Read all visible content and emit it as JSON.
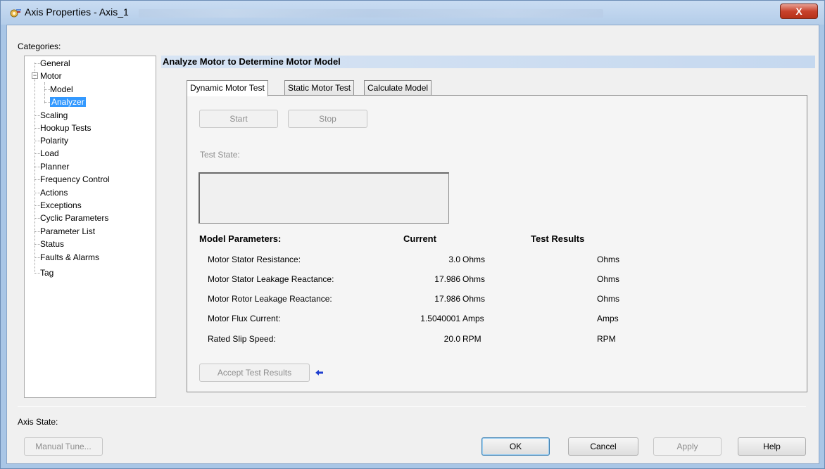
{
  "window": {
    "title": "Axis Properties - Axis_1",
    "close_label": "X"
  },
  "categories": {
    "label": "Categories:",
    "items": [
      {
        "label": "General"
      },
      {
        "label": "Motor"
      },
      {
        "label": "Model"
      },
      {
        "label": "Analyzer"
      },
      {
        "label": "Scaling"
      },
      {
        "label": "Hookup Tests"
      },
      {
        "label": "Polarity"
      },
      {
        "label": "Load"
      },
      {
        "label": "Planner"
      },
      {
        "label": "Frequency Control"
      },
      {
        "label": "Actions"
      },
      {
        "label": "Exceptions"
      },
      {
        "label": "Cyclic Parameters"
      },
      {
        "label": "Parameter List"
      },
      {
        "label": "Status"
      },
      {
        "label": "Faults & Alarms"
      },
      {
        "label": "Tag"
      }
    ],
    "selected": "Analyzer",
    "expander_symbol": "−"
  },
  "section": {
    "title": "Analyze Motor to Determine Motor Model"
  },
  "tabs": [
    {
      "label": "Dynamic Motor Test",
      "active": true
    },
    {
      "label": "Static Motor Test",
      "active": false
    },
    {
      "label": "Calculate Model",
      "active": false
    }
  ],
  "panel": {
    "start_label": "Start",
    "stop_label": "Stop",
    "test_state_label": "Test State:",
    "headers": {
      "model_parameters": "Model Parameters:",
      "current": "Current",
      "test_results": "Test Results"
    },
    "rows": [
      {
        "name": "Motor Stator Resistance:",
        "current": "3.0",
        "unit": "Ohms",
        "result_unit": "Ohms"
      },
      {
        "name": "Motor Stator Leakage Reactance:",
        "current": "17.986",
        "unit": "Ohms",
        "result_unit": "Ohms"
      },
      {
        "name": "Motor Rotor Leakage Reactance:",
        "current": "17.986",
        "unit": "Ohms",
        "result_unit": "Ohms"
      },
      {
        "name": "Motor Flux Current:",
        "current": "1.5040001",
        "unit": "Amps",
        "result_unit": "Amps"
      },
      {
        "name": "Rated Slip Speed:",
        "current": "20.0",
        "unit": "RPM",
        "result_unit": "RPM"
      }
    ],
    "accept_label": "Accept Test Results"
  },
  "footer": {
    "axis_state_label": "Axis State:",
    "manual_tune_label": "Manual Tune...",
    "ok_label": "OK",
    "cancel_label": "Cancel",
    "apply_label": "Apply",
    "help_label": "Help"
  },
  "colors": {
    "selection": "#3399ff",
    "header_band": "#c5d8ef",
    "accent_arrow": "#1f3fd0"
  }
}
